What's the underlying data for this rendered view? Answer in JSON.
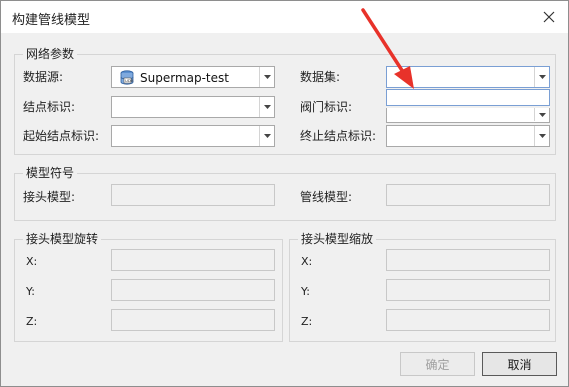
{
  "window": {
    "title": "构建管线模型",
    "close_label": "✕"
  },
  "network_params": {
    "legend": "网络参数",
    "datasource_label": "数据源:",
    "datasource_value": "Supermap-test",
    "dataset_label": "数据集:",
    "dataset_value": "",
    "node_id_label": "结点标识:",
    "node_id_value": "",
    "valve_id_label": "阀门标识:",
    "valve_id_value": "",
    "start_node_label": "起始结点标识:",
    "start_node_value": "",
    "end_node_label": "终止结点标识:",
    "end_node_value": ""
  },
  "model_symbol": {
    "legend": "模型符号",
    "joint_model_label": "接头模型:",
    "pipe_model_label": "管线模型:"
  },
  "joint_rotation": {
    "legend": "接头模型旋转",
    "x_label": "X:",
    "y_label": "Y:",
    "z_label": "Z:"
  },
  "joint_scale": {
    "legend": "接头模型缩放",
    "x_label": "X:",
    "y_label": "Y:",
    "z_label": "Z:"
  },
  "buttons": {
    "ok_label": "确定",
    "cancel_label": "取消"
  },
  "colors": {
    "annotation_arrow": "#e8322a",
    "dropdown_border": "#7a9fd4"
  }
}
